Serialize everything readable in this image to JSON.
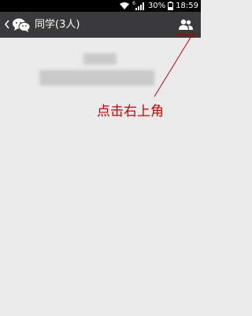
{
  "status_bar": {
    "network": "6",
    "battery": "30%",
    "time": "18:59"
  },
  "chat": {
    "back_label": "",
    "title": "同学(3人)"
  },
  "annotation": {
    "text": "点击右上角",
    "color": "#c80000"
  },
  "colors": {
    "title_bar": "#3a3a3c",
    "background": "#ebebeb",
    "status_bar": "#000000"
  }
}
